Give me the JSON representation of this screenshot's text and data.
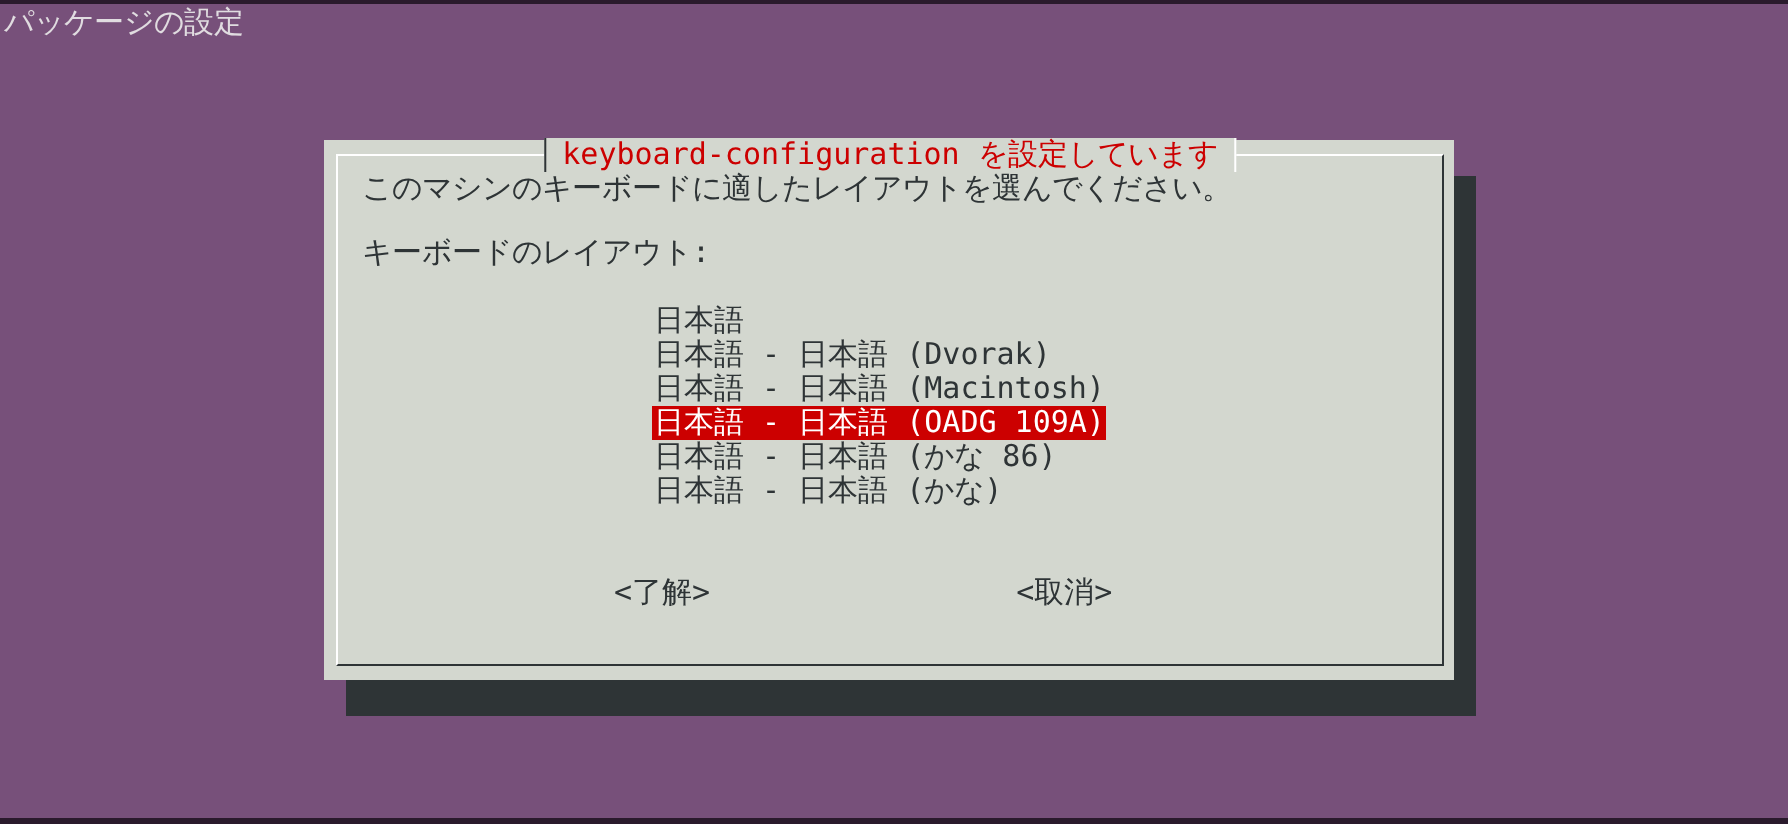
{
  "screen_title": "パッケージの設定",
  "dialog": {
    "title": "keyboard-configuration を設定しています",
    "prompt": "このマシンのキーボードに適したレイアウトを選んでください。",
    "list_label": "キーボードのレイアウト:",
    "options": [
      {
        "label": "日本語",
        "selected": false
      },
      {
        "label": "日本語 - 日本語 (Dvorak)",
        "selected": false
      },
      {
        "label": "日本語 - 日本語 (Macintosh)",
        "selected": false
      },
      {
        "label": "日本語 - 日本語 (OADG 109A)",
        "selected": true
      },
      {
        "label": "日本語 - 日本語 (かな 86)",
        "selected": false
      },
      {
        "label": "日本語 - 日本語 (かな)",
        "selected": false
      }
    ],
    "buttons": [
      "<了解>",
      "<取消>"
    ]
  }
}
